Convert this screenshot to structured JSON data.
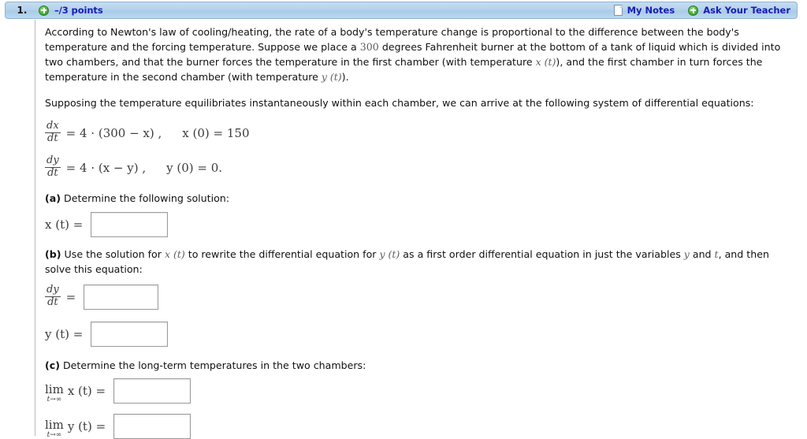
{
  "header": {
    "question_number": "1.",
    "plus_icon": "plus-circle-icon",
    "points": "–/3 points",
    "notes_icon": "document-icon",
    "notes_label": "My Notes",
    "teacher_plus_icon": "plus-circle-icon",
    "teacher_label": "Ask Your Teacher",
    "accent_color": "#1b1bb5",
    "bar_color": "#b6d3ec"
  },
  "problem": {
    "paragraph1_part1": "According to Newton's law of cooling/heating, the rate of a body's temperature change is proportional to the difference between the body's temperature and the forcing temperature. Suppose we place a ",
    "paragraph1_value": "300",
    "paragraph1_part2": " degrees Fahrenheit burner at the bottom of a tank of liquid which is divided into two chambers, and that the burner forces the temperature in the first chamber (with temperature ",
    "paragraph1_x": "x (t)",
    "paragraph1_part3": "), and the first chamber in turn forces the temperature in the second chamber (with temperature ",
    "paragraph1_y": "y (t)",
    "paragraph1_part4": ").",
    "paragraph2": "Supposing the temperature equilibriates instantaneously within each chamber, we can arrive at the following system of differential equations:"
  },
  "equations": {
    "eq1": {
      "frac_num": "dx",
      "frac_den": "dt",
      "rhs": "= 4 · (300 − x) ,",
      "initial_condition": "x (0) = 150"
    },
    "eq2": {
      "frac_num": "dy",
      "frac_den": "dt",
      "rhs": "= 4 · (x − y) ,",
      "initial_condition": "y (0) = 0."
    }
  },
  "parts": {
    "a": {
      "label": "(a)",
      "prompt": " Determine the following solution:",
      "answer_lead": "x (t) =",
      "answer_value": "",
      "answer_placeholder": ""
    },
    "b": {
      "label": "(b)",
      "prompt_part1": " Use the solution for ",
      "prompt_x": "x (t)",
      "prompt_part2": " to rewrite the differential equation for ",
      "prompt_y": "y (t)",
      "prompt_part3": " as a first order differential equation in just the variables ",
      "prompt_var_y": "y",
      "prompt_part4": " and ",
      "prompt_var_t": "t",
      "prompt_part5": ", and then solve this equation:",
      "frac_num": "dy",
      "frac_den": "dt",
      "frac_eq": "=",
      "answer1_value": "",
      "answer2_lead": "y (t) =",
      "answer2_value": ""
    },
    "c": {
      "label": "(c)",
      "prompt": " Determine the long-term temperatures in the two chambers:",
      "limit_op": "lim",
      "limit_sub": "t→∞",
      "answer1_lead": "x (t) =",
      "answer1_value": "",
      "answer2_lead": "y (t) =",
      "answer2_value": ""
    }
  }
}
